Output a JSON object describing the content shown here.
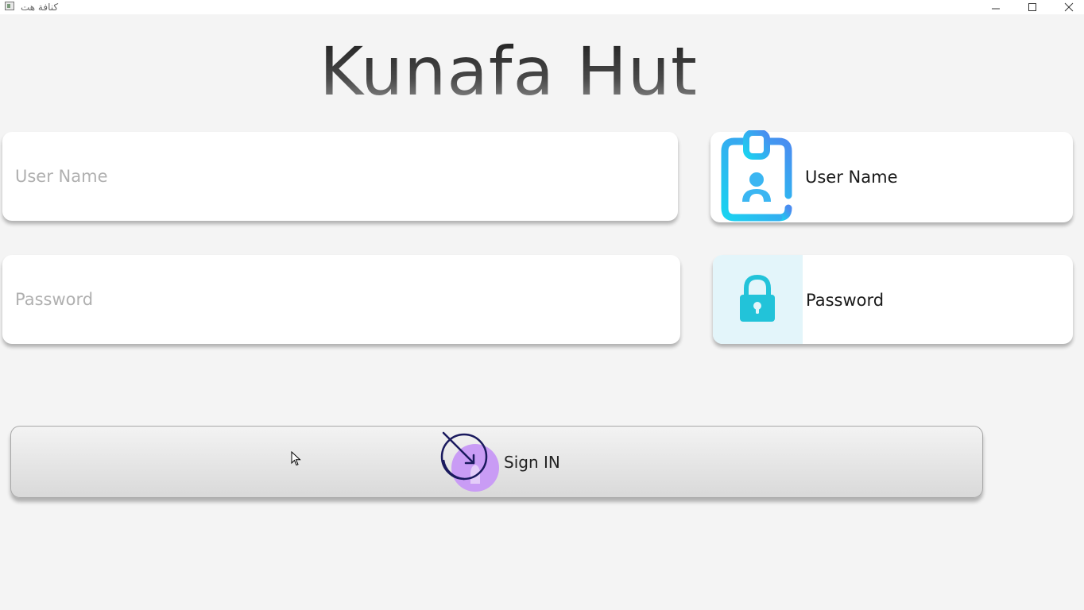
{
  "window": {
    "title": "كنافة هت"
  },
  "app": {
    "title": "Kunafa Hut"
  },
  "form": {
    "username": {
      "value": "",
      "placeholder": "User Name",
      "label": "User Name",
      "icon": "id-badge-icon"
    },
    "password": {
      "value": "",
      "placeholder": "Password",
      "label": "Password",
      "icon": "lock-icon"
    },
    "signin": {
      "label": "Sign IN",
      "icon": "sign-in-icon"
    }
  },
  "colors": {
    "background": "#f4f4f4",
    "badge_gradient_start": "#1ad3f0",
    "badge_gradient_end": "#4a8cf0",
    "lock_color": "#22c3d9",
    "lock_tile": "#e3f5fa",
    "signin_icon_circle": "#c99cf5",
    "signin_icon_stroke": "#1a1a5e"
  }
}
